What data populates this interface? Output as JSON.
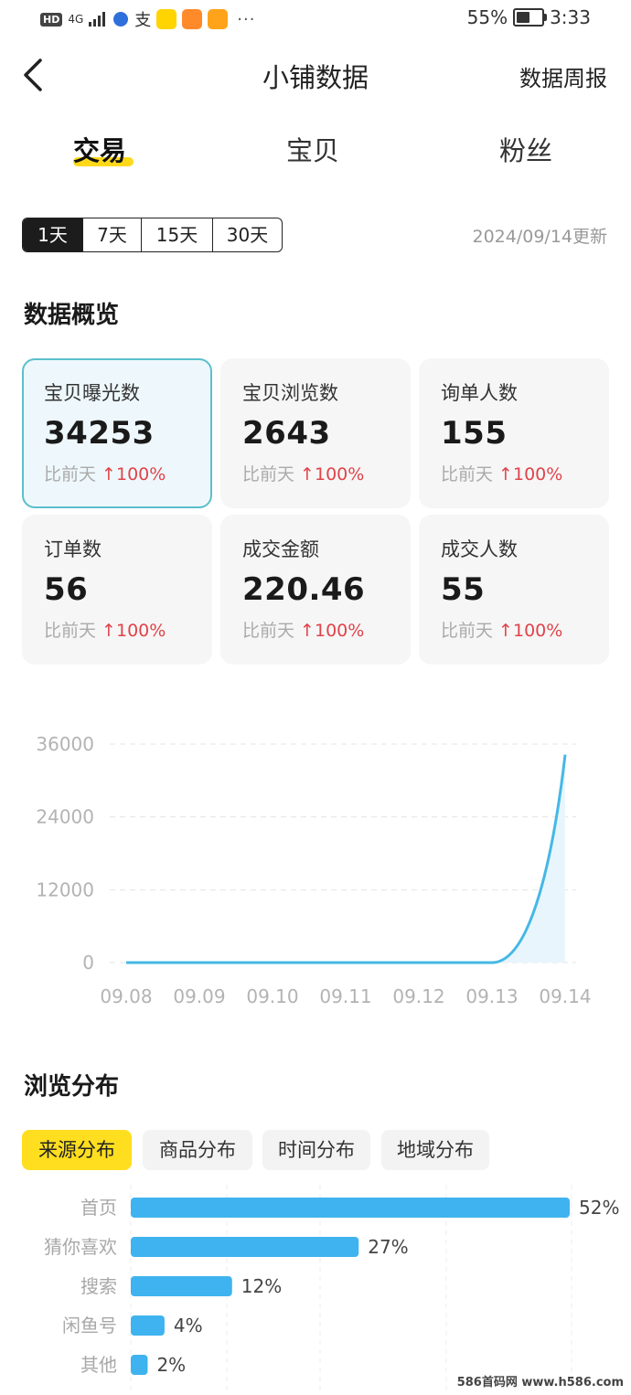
{
  "status_bar": {
    "left_badge": "HD",
    "network": "4G",
    "app_text": "支",
    "battery": "55%",
    "time": "3:33"
  },
  "navbar": {
    "title": "小铺数据",
    "right_link": "数据周报"
  },
  "tabs": [
    {
      "label": "交易",
      "active": true
    },
    {
      "label": "宝贝",
      "active": false
    },
    {
      "label": "粉丝",
      "active": false
    }
  ],
  "periods": [
    "1天",
    "7天",
    "15天",
    "30天"
  ],
  "update_text": "2024/09/14更新",
  "overview": {
    "title": "数据概览",
    "compare_label": "比前天",
    "cards": [
      {
        "label": "宝贝曝光数",
        "value": "34253",
        "change": "100%"
      },
      {
        "label": "宝贝浏览数",
        "value": "2643",
        "change": "100%"
      },
      {
        "label": "询单人数",
        "value": "155",
        "change": "100%"
      },
      {
        "label": "订单数",
        "value": "56",
        "change": "100%"
      },
      {
        "label": "成交金额",
        "value": "220.46",
        "change": "100%"
      },
      {
        "label": "成交人数",
        "value": "55",
        "change": "100%"
      }
    ]
  },
  "chart_data": [
    {
      "type": "area",
      "x": [
        "09.08",
        "09.09",
        "09.10",
        "09.11",
        "09.12",
        "09.13",
        "09.14"
      ],
      "values": [
        0,
        0,
        0,
        0,
        0,
        0,
        34253
      ],
      "yticks": [
        "0",
        "12000",
        "24000",
        "36000"
      ],
      "ylim": [
        0,
        36000
      ],
      "color": "#45b8e5"
    },
    {
      "type": "bar",
      "orientation": "horizontal",
      "categories": [
        "首页",
        "猜你喜欢",
        "搜索",
        "闲鱼号",
        "其他"
      ],
      "values": [
        52,
        27,
        12,
        4,
        2
      ],
      "value_labels": [
        "52%",
        "27%",
        "12%",
        "4%",
        "2%"
      ],
      "color": "#3fb3ef"
    }
  ],
  "browse": {
    "title": "浏览分布",
    "tabs": [
      "来源分布",
      "商品分布",
      "时间分布",
      "地域分布"
    ]
  },
  "watermark": "586首码网 www.h586.com"
}
